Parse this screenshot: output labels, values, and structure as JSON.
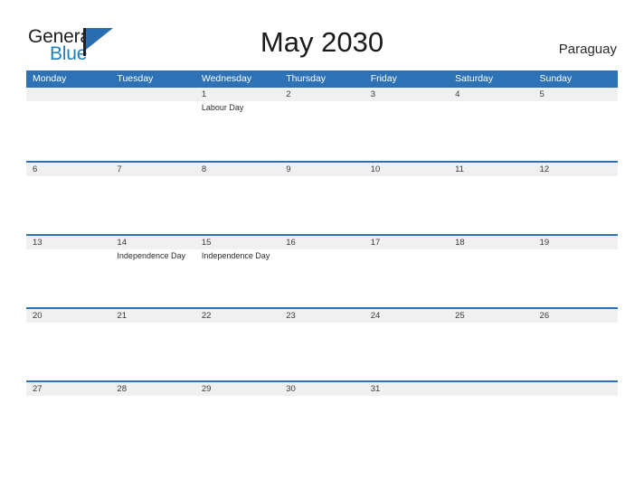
{
  "brand": {
    "word_one": "General",
    "word_two": "Blue",
    "flag_icon": "flag-triangle-icon",
    "accent_color": "#2a6db0",
    "blue_text_color": "#1a7fc1"
  },
  "header": {
    "title": "May 2030",
    "country": "Paraguay"
  },
  "theme": {
    "header_blue": "#2d72b5",
    "stripe_gray": "#f0f0f0",
    "divider_blue": "#2d72b5",
    "text_dark": "#3a3a3a"
  },
  "calendar": {
    "month": "May",
    "year": "2030",
    "weekday_headers": [
      "Monday",
      "Tuesday",
      "Wednesday",
      "Thursday",
      "Friday",
      "Saturday",
      "Sunday"
    ],
    "weeks": [
      [
        {
          "day": "",
          "event": ""
        },
        {
          "day": "",
          "event": ""
        },
        {
          "day": "1",
          "event": "Labour Day"
        },
        {
          "day": "2",
          "event": ""
        },
        {
          "day": "3",
          "event": ""
        },
        {
          "day": "4",
          "event": ""
        },
        {
          "day": "5",
          "event": ""
        }
      ],
      [
        {
          "day": "6",
          "event": ""
        },
        {
          "day": "7",
          "event": ""
        },
        {
          "day": "8",
          "event": ""
        },
        {
          "day": "9",
          "event": ""
        },
        {
          "day": "10",
          "event": ""
        },
        {
          "day": "11",
          "event": ""
        },
        {
          "day": "12",
          "event": ""
        }
      ],
      [
        {
          "day": "13",
          "event": ""
        },
        {
          "day": "14",
          "event": "Independence Day"
        },
        {
          "day": "15",
          "event": "Independence Day"
        },
        {
          "day": "16",
          "event": ""
        },
        {
          "day": "17",
          "event": ""
        },
        {
          "day": "18",
          "event": ""
        },
        {
          "day": "19",
          "event": ""
        }
      ],
      [
        {
          "day": "20",
          "event": ""
        },
        {
          "day": "21",
          "event": ""
        },
        {
          "day": "22",
          "event": ""
        },
        {
          "day": "23",
          "event": ""
        },
        {
          "day": "24",
          "event": ""
        },
        {
          "day": "25",
          "event": ""
        },
        {
          "day": "26",
          "event": ""
        }
      ],
      [
        {
          "day": "27",
          "event": ""
        },
        {
          "day": "28",
          "event": ""
        },
        {
          "day": "29",
          "event": ""
        },
        {
          "day": "30",
          "event": ""
        },
        {
          "day": "31",
          "event": ""
        },
        {
          "day": "",
          "event": ""
        },
        {
          "day": "",
          "event": ""
        }
      ]
    ]
  }
}
